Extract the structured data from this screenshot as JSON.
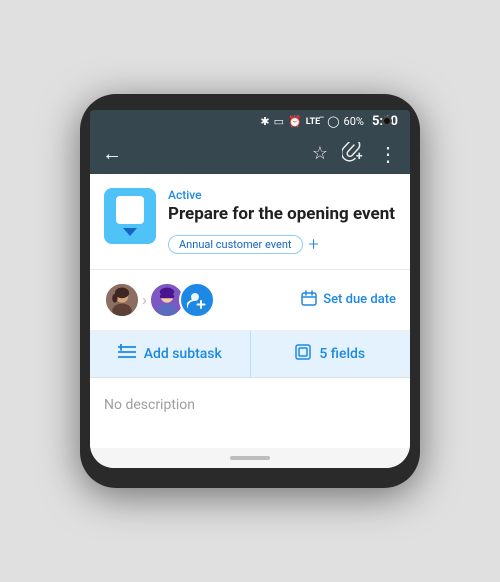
{
  "phone": {
    "camera": true
  },
  "statusBar": {
    "battery": "60%",
    "time": "5:10",
    "icons": [
      "bluetooth",
      "vibrate",
      "alarm",
      "lte",
      "battery-circle"
    ]
  },
  "toolbar": {
    "back_label": "←",
    "star_icon": "☆",
    "attach_icon": "🖇",
    "more_icon": "⋮"
  },
  "task": {
    "status": "Active",
    "title": "Prepare for the opening event",
    "tag": "Annual customer event",
    "add_tag_label": "+",
    "due_date_label": "Set due date",
    "add_subtask_label": "Add subtask",
    "fields_label": "5 fields",
    "description_label": "No description"
  }
}
